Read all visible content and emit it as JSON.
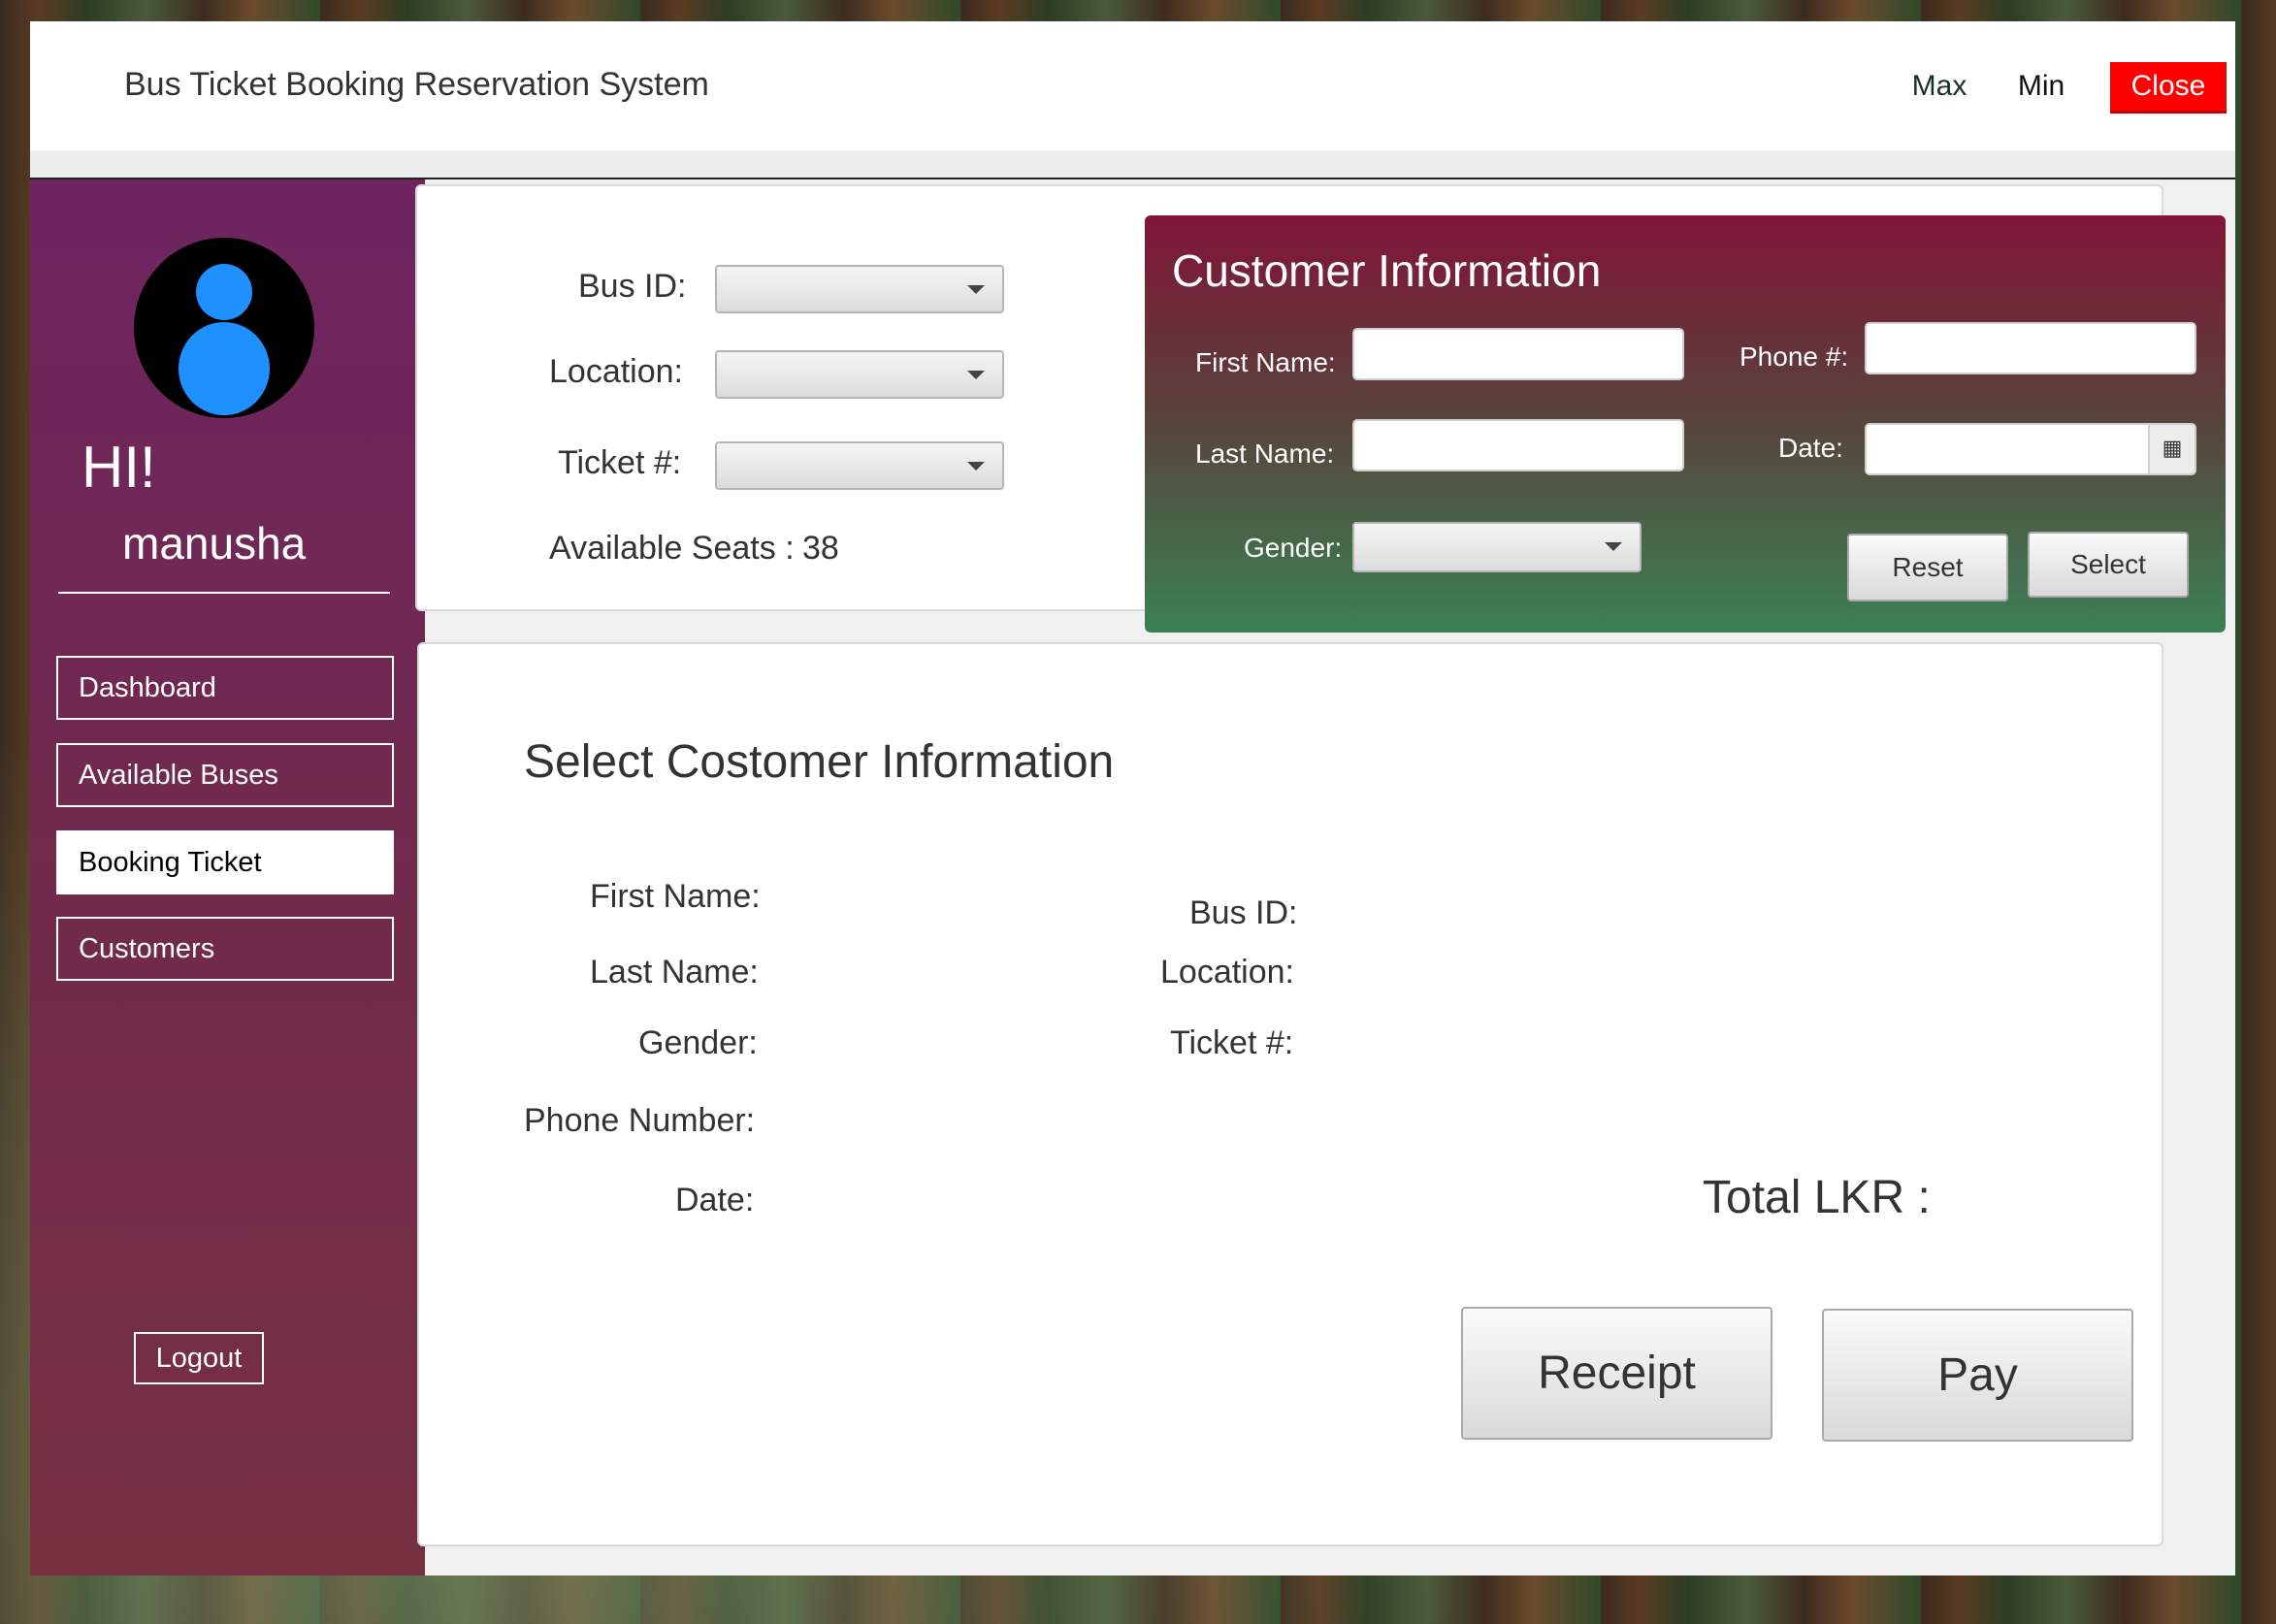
{
  "window": {
    "title": "Bus Ticket Booking Reservation System",
    "max_label": "Max",
    "min_label": "Min",
    "close_label": "Close",
    "close_color": "#ff0000"
  },
  "sidebar": {
    "greeting": "HI!",
    "username": "manusha",
    "items": [
      {
        "label": "Dashboard",
        "active": false
      },
      {
        "label": "Available Buses",
        "active": false
      },
      {
        "label": "Booking Ticket",
        "active": true
      },
      {
        "label": "Customers",
        "active": false
      }
    ],
    "logout_label": "Logout",
    "colors": {
      "top": "#6d2560",
      "bottom": "#763040",
      "avatar": "#1e90ff"
    }
  },
  "booking": {
    "bus_id_label": "Bus ID:",
    "location_label": "Location:",
    "ticket_label": "Ticket #:",
    "available_seats_label": "Available Seats :",
    "available_seats_value": "38"
  },
  "customer_info": {
    "title": "Customer Information",
    "first_name_label": "First Name:",
    "last_name_label": "Last Name:",
    "gender_label": "Gender:",
    "phone_label": "Phone #:",
    "date_label": "Date:",
    "first_name_value": "",
    "last_name_value": "",
    "phone_value": "",
    "date_value": "",
    "reset_label": "Reset",
    "select_label": "Select",
    "calendar_icon": "calendar-icon",
    "colors": {
      "top": "#821538",
      "bottom": "#3b8055"
    }
  },
  "summary": {
    "title": "Select Costomer Information",
    "first_name_label": "First Name:",
    "last_name_label": "Last Name:",
    "gender_label": "Gender:",
    "phone_label": "Phone Number:",
    "date_label": "Date:",
    "bus_id_label": "Bus ID:",
    "location_label": "Location:",
    "ticket_label": "Ticket #:",
    "total_label": "Total LKR :",
    "receipt_label": "Receipt",
    "pay_label": "Pay"
  }
}
